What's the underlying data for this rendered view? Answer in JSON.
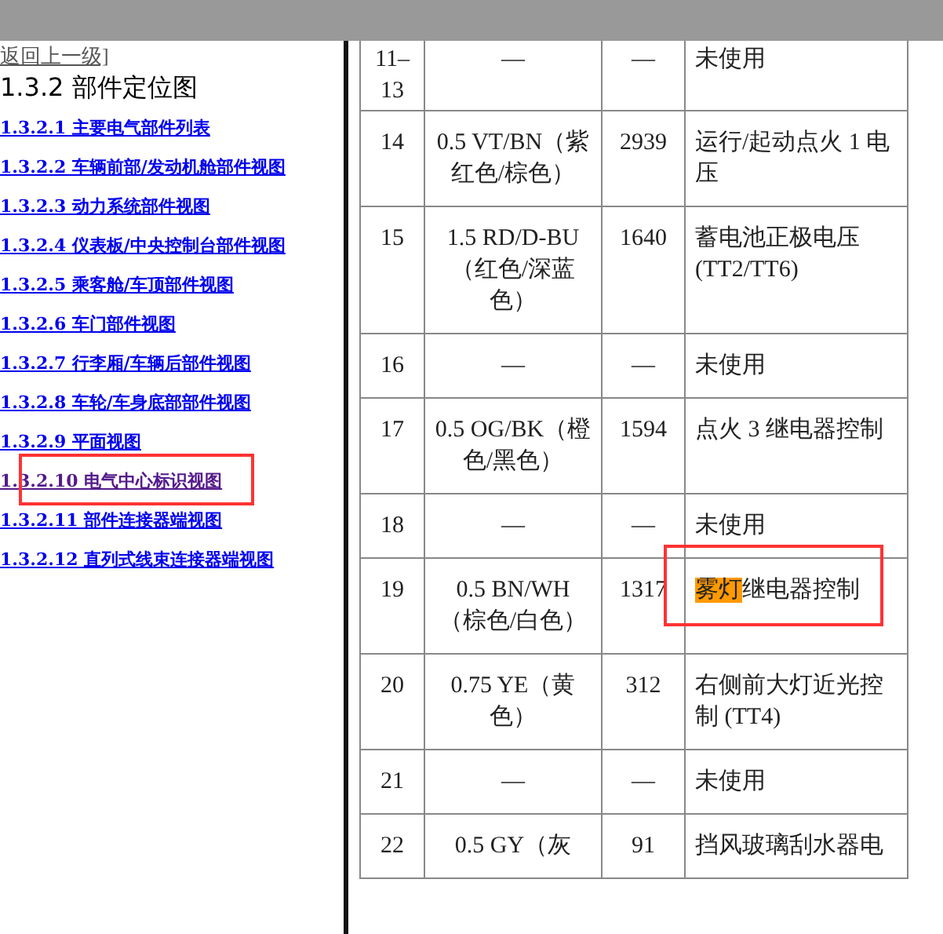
{
  "nav": {
    "back_link": "返回上一级]",
    "heading": "1.3.2 部件定位图",
    "links": [
      {
        "number": "1.3.2.1",
        "label": "主要电气部件列表",
        "visited": false,
        "annotated": false
      },
      {
        "number": "1.3.2.2",
        "label": "车辆前部/发动机舱部件视图",
        "visited": false,
        "annotated": false
      },
      {
        "number": "1.3.2.3",
        "label": "动力系统部件视图",
        "visited": false,
        "annotated": false
      },
      {
        "number": "1.3.2.4",
        "label": "仪表板/中央控制台部件视图",
        "visited": false,
        "annotated": false
      },
      {
        "number": "1.3.2.5",
        "label": "乘客舱/车顶部件视图",
        "visited": false,
        "annotated": false
      },
      {
        "number": "1.3.2.6",
        "label": "车门部件视图",
        "visited": false,
        "annotated": false
      },
      {
        "number": "1.3.2.7",
        "label": "行李厢/车辆后部件视图",
        "visited": false,
        "annotated": false
      },
      {
        "number": "1.3.2.8",
        "label": "车轮/车身底部部件视图",
        "visited": false,
        "annotated": false
      },
      {
        "number": "1.3.2.9",
        "label": "平面视图",
        "visited": false,
        "annotated": false
      },
      {
        "number": "1.3.2.10",
        "label": "电气中心标识视图",
        "visited": true,
        "annotated": true
      },
      {
        "number": "1.3.2.11",
        "label": "部件连接器端视图",
        "visited": false,
        "annotated": false
      },
      {
        "number": "1.3.2.12",
        "label": "直列式线束连接器端视图",
        "visited": false,
        "annotated": false
      }
    ]
  },
  "table": {
    "rows": [
      {
        "pin": "11–13",
        "wire": "—",
        "circuit": "—",
        "function": [
          {
            "text": "未使用",
            "highlighted": false
          }
        ],
        "annotated": false
      },
      {
        "pin": "14",
        "wire": "0.5 VT/BN（紫红色/棕色）",
        "circuit": "2939",
        "function": [
          {
            "text": "运行/起动点火 1 电压",
            "highlighted": false
          }
        ],
        "annotated": false
      },
      {
        "pin": "15",
        "wire": "1.5 RD/D-BU（红色/深蓝色）",
        "circuit": "1640",
        "function": [
          {
            "text": "蓄电池正极电压 (TT2/TT6)",
            "highlighted": false
          }
        ],
        "annotated": false
      },
      {
        "pin": "16",
        "wire": "—",
        "circuit": "—",
        "function": [
          {
            "text": "未使用",
            "highlighted": false
          }
        ],
        "annotated": false
      },
      {
        "pin": "17",
        "wire": "0.5 OG/BK（橙色/黑色）",
        "circuit": "1594",
        "function": [
          {
            "text": "点火 3 继电器控制",
            "highlighted": false
          }
        ],
        "annotated": false
      },
      {
        "pin": "18",
        "wire": "—",
        "circuit": "—",
        "function": [
          {
            "text": "未使用",
            "highlighted": false
          }
        ],
        "annotated": false
      },
      {
        "pin": "19",
        "wire": "0.5 BN/WH（棕色/白色）",
        "circuit": "1317",
        "function": [
          {
            "text": "雾灯",
            "highlighted": true
          },
          {
            "text": "继电器控制",
            "highlighted": false
          }
        ],
        "annotated": true
      },
      {
        "pin": "20",
        "wire": "0.75 YE（黄色）",
        "circuit": "312",
        "function": [
          {
            "text": "右侧前大灯近光控制 (TT4)",
            "highlighted": false
          }
        ],
        "annotated": false
      },
      {
        "pin": "21",
        "wire": "—",
        "circuit": "—",
        "function": [
          {
            "text": "未使用",
            "highlighted": false
          }
        ],
        "annotated": false
      },
      {
        "pin": "22",
        "wire": "0.5 GY（灰",
        "circuit": "91",
        "function": [
          {
            "text": "挡风玻璃刮水器电",
            "highlighted": false
          }
        ],
        "annotated": false
      }
    ]
  }
}
